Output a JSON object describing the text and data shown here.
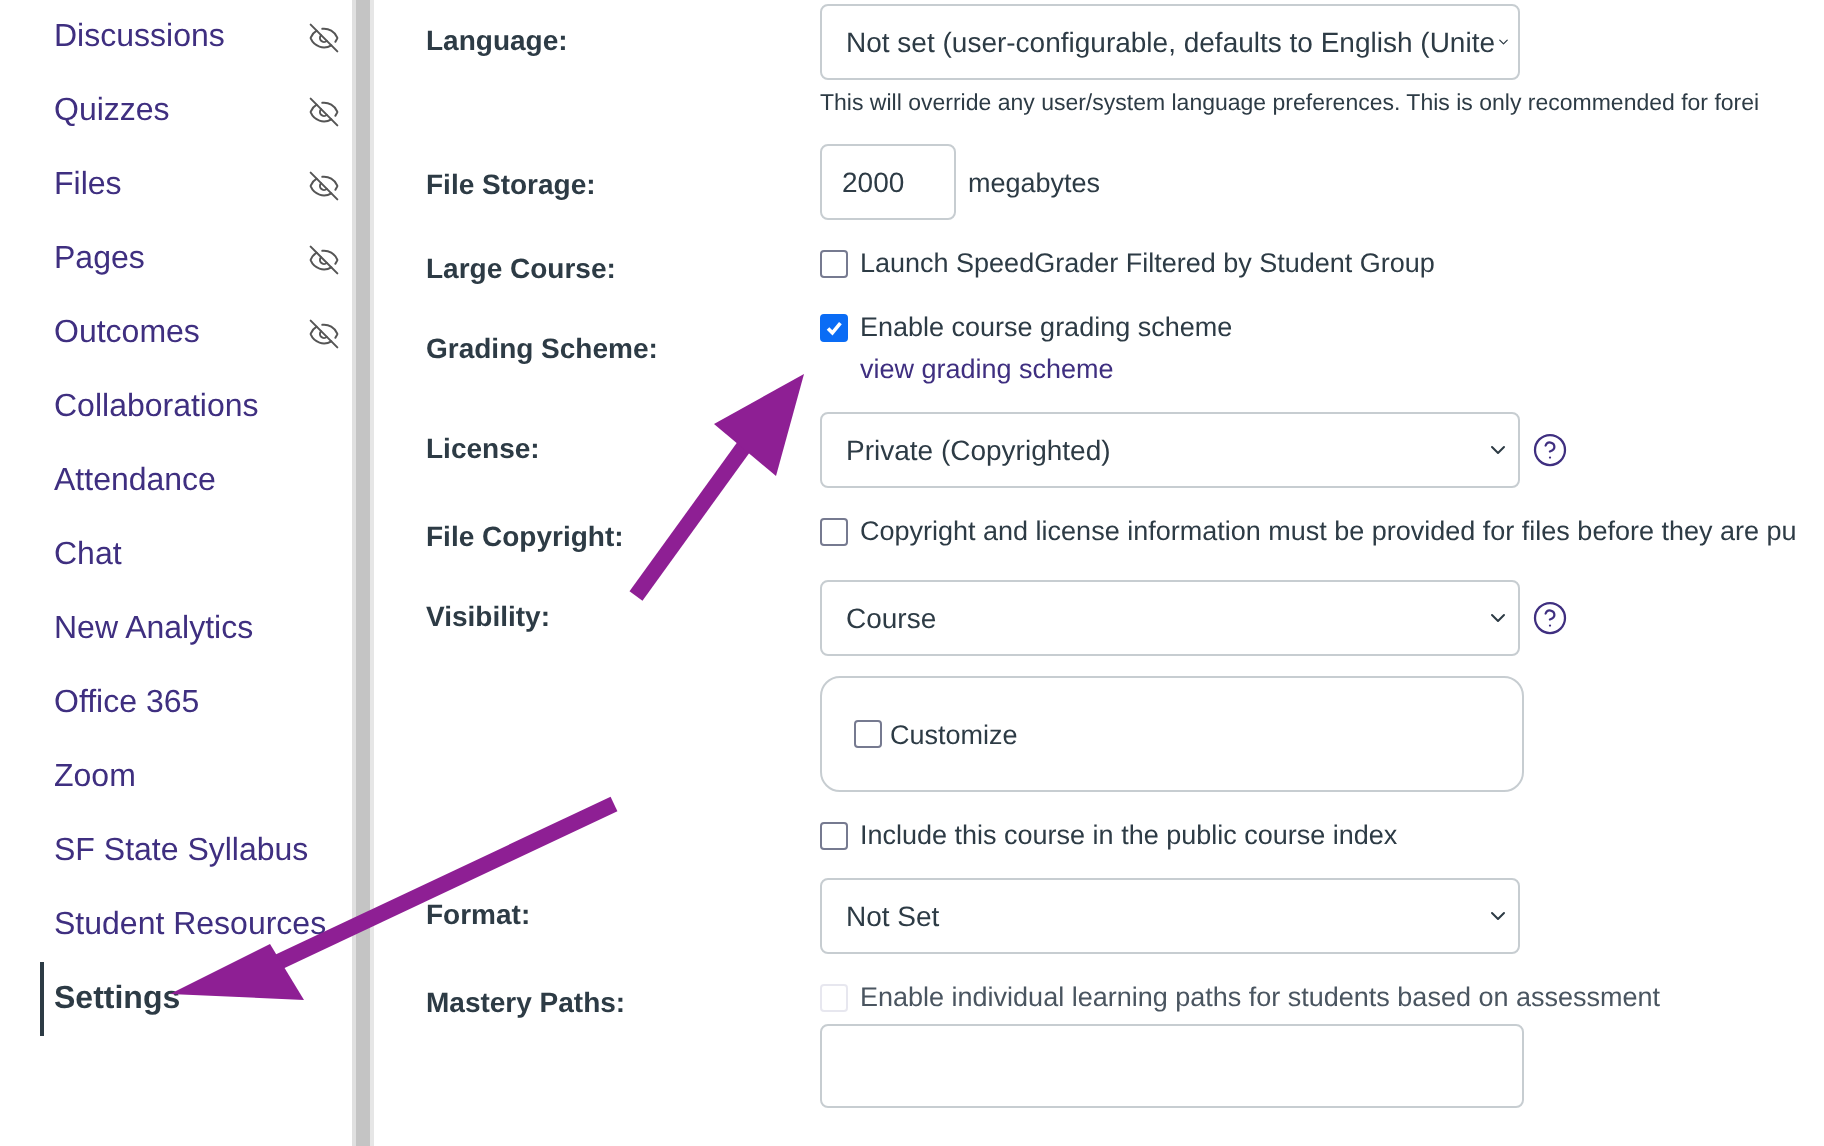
{
  "sidebar": {
    "items": [
      {
        "label": "Discussions",
        "hidden": true,
        "selected": false
      },
      {
        "label": "Quizzes",
        "hidden": true,
        "selected": false
      },
      {
        "label": "Files",
        "hidden": true,
        "selected": false
      },
      {
        "label": "Pages",
        "hidden": true,
        "selected": false
      },
      {
        "label": "Outcomes",
        "hidden": true,
        "selected": false
      },
      {
        "label": "Collaborations",
        "hidden": false,
        "selected": false
      },
      {
        "label": "Attendance",
        "hidden": false,
        "selected": false
      },
      {
        "label": "Chat",
        "hidden": false,
        "selected": false
      },
      {
        "label": "New Analytics",
        "hidden": false,
        "selected": false
      },
      {
        "label": "Office 365",
        "hidden": false,
        "selected": false
      },
      {
        "label": "Zoom",
        "hidden": false,
        "selected": false
      },
      {
        "label": "SF State Syllabus",
        "hidden": false,
        "selected": false
      },
      {
        "label": "Student Resources",
        "hidden": false,
        "selected": false
      },
      {
        "label": "Settings",
        "hidden": false,
        "selected": true
      }
    ]
  },
  "settings": [
    {
      "kind": "select",
      "label": "Language:",
      "value": "Not set (user-configurable, defaults to English (Unite",
      "note": "This will override any user/system language preferences. This is only recommended for forei"
    },
    {
      "kind": "number",
      "label": "File Storage:",
      "value": "2000",
      "unit": "megabytes"
    },
    {
      "kind": "checkbox",
      "label": "Large Course:",
      "text": "Launch SpeedGrader Filtered by Student Group",
      "checked": false,
      "disabled": false
    },
    {
      "kind": "checkbox",
      "label": "Grading Scheme:",
      "text": "Enable course grading scheme",
      "checked": true,
      "disabled": false,
      "link": "view grading scheme"
    },
    {
      "kind": "select",
      "label": "License:",
      "value": "Private (Copyrighted)",
      "help": true
    },
    {
      "kind": "checkbox",
      "label": "File Copyright:",
      "text": "Copyright and license information must be provided for files before they are pu",
      "checked": false,
      "disabled": false
    },
    {
      "kind": "select",
      "label": "Visibility:",
      "value": "Course",
      "help": true,
      "customize": {
        "text": "Customize",
        "checked": false
      }
    },
    {
      "kind": "checkbox",
      "text": "Include this course in the public course index",
      "checked": false,
      "disabled": false
    },
    {
      "kind": "select",
      "label": "Format:",
      "value": "Not Set"
    },
    {
      "kind": "checkbox",
      "label": "Mastery Paths:",
      "text": "Enable individual learning paths for students based on assessment",
      "checked": false,
      "disabled": true,
      "box": true
    }
  ]
}
